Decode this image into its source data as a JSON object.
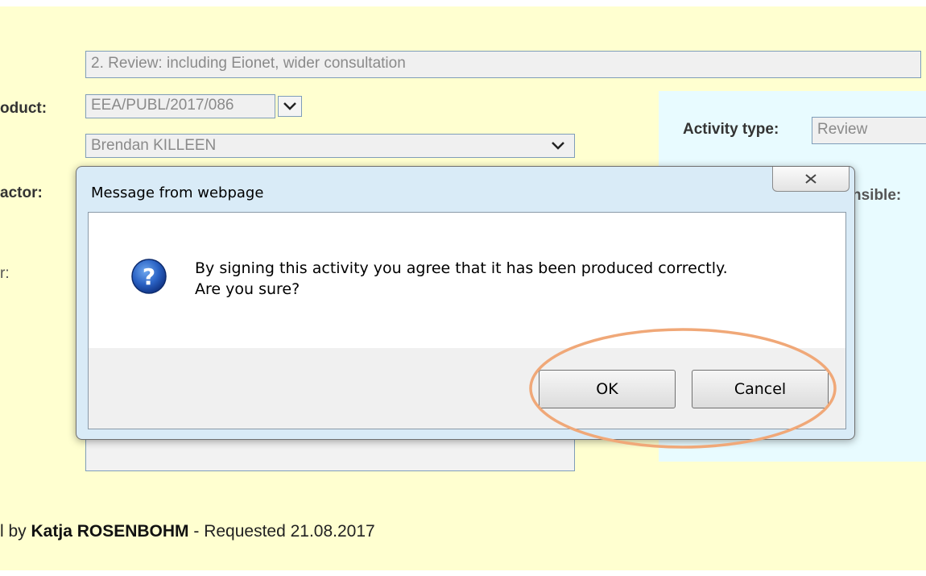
{
  "form": {
    "phase_value": "2. Review: including Eionet, wider consultation",
    "product_label": "oduct:",
    "product_value": "EEA/PUBL/2017/086",
    "person_value": "Brendan KILLEEN",
    "actor_label": "actor:",
    "partial_label": "r:",
    "activity_type_label": "Activity type:",
    "activity_type_value": "Review",
    "responsible_label": "nsible:"
  },
  "footer": {
    "prefix": "l by ",
    "requester": "Katja ROSENBOHM",
    "suffix": " - Requested 21.08.2017"
  },
  "dialog": {
    "title": "Message from webpage",
    "message_line1": "By signing this activity you agree that it has been produced correctly.",
    "message_line2": "Are you sure?",
    "ok_label": "OK",
    "cancel_label": "Cancel",
    "icon": "question-icon"
  },
  "colors": {
    "page_background": "#ffffd0",
    "right_panel": "#e8fbff",
    "annotation_ellipse": "#f0a878"
  }
}
